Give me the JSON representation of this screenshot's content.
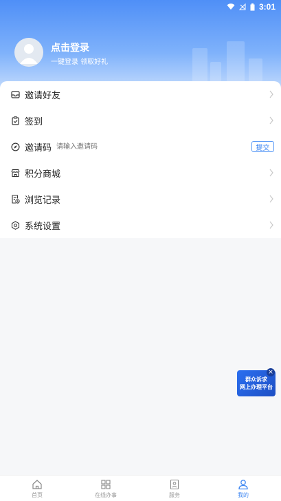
{
  "status_bar": {
    "time": "3:01"
  },
  "profile": {
    "title": "点击登录",
    "subtitle": "一键登录   领取好礼"
  },
  "menu": [
    {
      "label": "邀请好友",
      "icon": "inbox-icon"
    },
    {
      "label": "签到",
      "icon": "clipboard-check-icon"
    },
    {
      "label": "邀请码",
      "icon": "compass-icon"
    },
    {
      "label": "积分商城",
      "icon": "store-icon"
    },
    {
      "label": "浏览记录",
      "icon": "history-doc-icon"
    },
    {
      "label": "系统设置",
      "icon": "gear-icon"
    }
  ],
  "invite": {
    "placeholder": "请输入邀请码",
    "submit_label": "提交"
  },
  "float_banner": {
    "line1": "群众诉求",
    "line2": "网上办理平台",
    "close": "×"
  },
  "tabs": [
    {
      "label": "首页",
      "icon": "home-icon"
    },
    {
      "label": "在线办事",
      "icon": "grid-icon"
    },
    {
      "label": "服务",
      "icon": "bookmark-icon"
    },
    {
      "label": "我的",
      "icon": "user-icon"
    }
  ],
  "colors": {
    "accent": "#3d86f2",
    "header_top": "#4f8ff7",
    "header_bottom": "#cfe2fd"
  }
}
